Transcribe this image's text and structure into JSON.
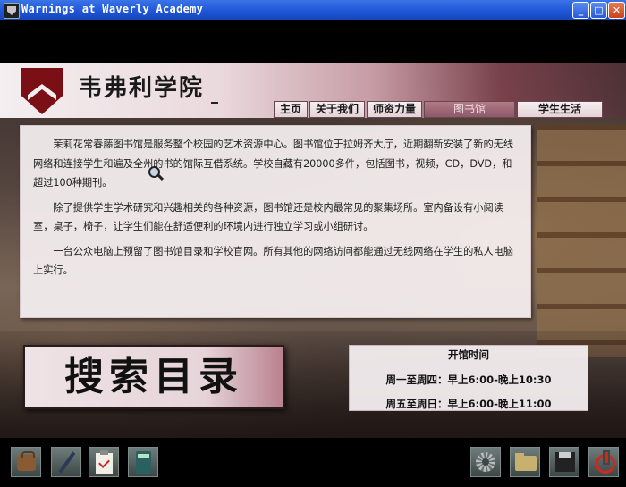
{
  "window": {
    "title": "Warnings at Waverly Academy",
    "min_glyph": "_",
    "max_glyph": "□",
    "close_glyph": "✕"
  },
  "site": {
    "academy_name": "韦弗利学院",
    "crest_icon": "shield-chevron-crest-icon",
    "crest_color": "#7a1016"
  },
  "nav": {
    "tabs": [
      {
        "label": "主页"
      },
      {
        "label": "关于我们"
      },
      {
        "label": "师资力量"
      },
      {
        "label": "图书馆",
        "active": true
      },
      {
        "label": "学生生活"
      }
    ]
  },
  "library": {
    "paragraphs": [
      "茉莉花常春藤图书馆是服务整个校园的艺术资源中心。图书馆位于拉姆齐大厅，近期翻新安装了新的无线网络和连接学生和遍及全州的书的馆际互借系统。学校自藏有20000多件，包括图书，视频，CD，DVD，和超过100种期刊。",
      "除了提供学生学术研究和兴趣相关的各种资源，图书馆还是校内最常见的聚集场所。室内备设有小阅读室，桌子，椅子，让学生们能在舒适便利的环境内进行独立学习或小组研讨。",
      "一台公众电脑上预留了图书馆目录和学校官网。所有其他的网络访问都能通过无线网络在学生的私人电脑上实行。"
    ],
    "search_label": "搜索目录"
  },
  "hours": {
    "title": "开馆时间",
    "weekday": "周一至周四：早上6:00-晚上10:30",
    "weekend": "周五至周日：早上6:00-晚上11:00"
  },
  "toolbar": {
    "left": [
      "briefcase-icon",
      "pen-icon",
      "clipboard-checklist-icon",
      "calculator-icon"
    ],
    "right": [
      "saw-blade-icon",
      "folder-icon",
      "floppy-disk-icon",
      "power-icon"
    ],
    "power_color": "#d0281c"
  }
}
